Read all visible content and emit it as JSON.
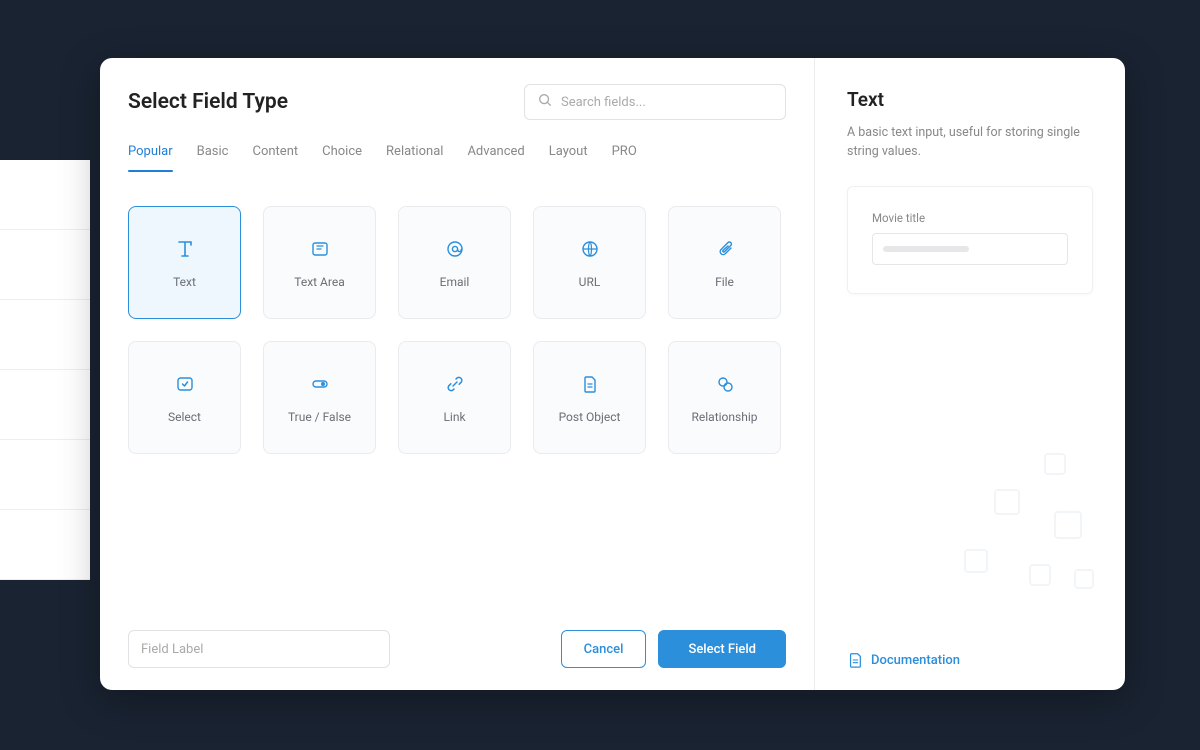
{
  "header": {
    "title": "Select Field Type",
    "search_placeholder": "Search fields..."
  },
  "tabs": [
    {
      "label": "Popular",
      "active": true
    },
    {
      "label": "Basic"
    },
    {
      "label": "Content"
    },
    {
      "label": "Choice"
    },
    {
      "label": "Relational"
    },
    {
      "label": "Advanced"
    },
    {
      "label": "Layout"
    },
    {
      "label": "PRO"
    }
  ],
  "tiles": [
    {
      "id": "text",
      "label": "Text",
      "icon": "text-icon",
      "selected": true
    },
    {
      "id": "text-area",
      "label": "Text Area",
      "icon": "textarea-icon"
    },
    {
      "id": "email",
      "label": "Email",
      "icon": "at-icon"
    },
    {
      "id": "url",
      "label": "URL",
      "icon": "globe-icon"
    },
    {
      "id": "file",
      "label": "File",
      "icon": "paperclip-icon"
    },
    {
      "id": "select",
      "label": "Select",
      "icon": "select-icon"
    },
    {
      "id": "true-false",
      "label": "True / False",
      "icon": "toggle-icon"
    },
    {
      "id": "link",
      "label": "Link",
      "icon": "link-icon"
    },
    {
      "id": "post-object",
      "label": "Post Object",
      "icon": "document-icon"
    },
    {
      "id": "relationship",
      "label": "Relationship",
      "icon": "relationship-icon"
    }
  ],
  "footer": {
    "field_label_placeholder": "Field Label",
    "cancel_label": "Cancel",
    "select_label": "Select Field"
  },
  "sidebar": {
    "title": "Text",
    "description": "A basic text input, useful for storing single string values.",
    "preview_label": "Movie title",
    "doc_label": "Documentation"
  },
  "colors": {
    "accent": "#2b8fdb",
    "bg": "#1a2332"
  }
}
